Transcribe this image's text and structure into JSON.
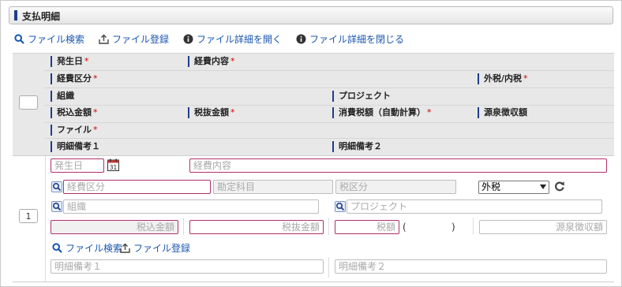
{
  "panel": {
    "title": "支払明細"
  },
  "toolbar": {
    "file_search": "ファイル検索",
    "file_register": "ファイル登録",
    "open_details": "ファイル詳細を開く",
    "close_details": "ファイル詳細を閉じる"
  },
  "header": {
    "occurrence_date": "発生日",
    "expense_content": "経費内容",
    "expense_category": "経費区分",
    "tax_type": "外税/内税",
    "organization": "組織",
    "project": "プロジェクト",
    "tax_included_amount": "税込金額",
    "tax_excluded_amount": "税抜金額",
    "consumption_tax": "消費税額（自動計算）",
    "withholding_amount": "源泉徴収額",
    "file": "ファイル",
    "memo1": "明細備考１",
    "memo2": "明細備考２",
    "required_mark": "*"
  },
  "row": {
    "number": "1",
    "date_placeholder": "発生日",
    "expense_content_placeholder": "経費内容",
    "expense_category_placeholder": "経費区分",
    "account_item_placeholder": "勘定科目",
    "tax_category_placeholder": "税区分",
    "tax_type_value": "外税",
    "organization_placeholder": "組織",
    "project_placeholder": "プロジェクト",
    "tax_included_placeholder": "税込金額",
    "tax_excluded_placeholder": "税抜金額",
    "tax_placeholder": "税額",
    "tax_open_paren": "(",
    "tax_close_paren": ")",
    "withholding_placeholder": "源泉徴収額",
    "file_search": "ファイル検索",
    "file_register": "ファイル登録",
    "memo1_placeholder": "明細備考１",
    "memo2_placeholder": "明細備考２"
  },
  "colors": {
    "accent": "#1f3d8b",
    "link": "#1a56b0",
    "required": "#cc0000",
    "required_border": "#b0306a"
  }
}
